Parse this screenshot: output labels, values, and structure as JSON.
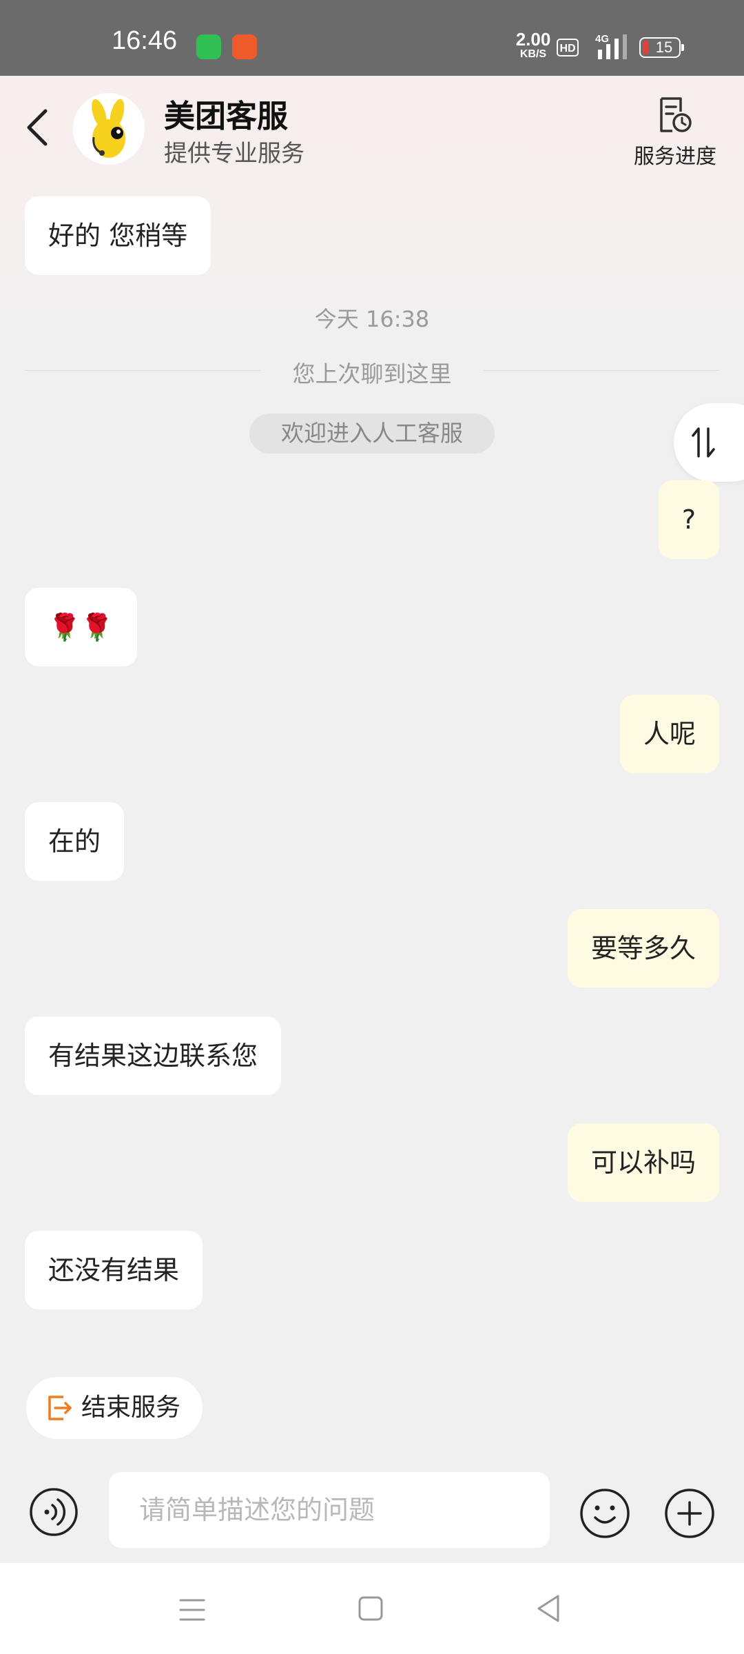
{
  "status_bar": {
    "time": "16:46",
    "net_speed_value": "2.00",
    "net_speed_unit": "KB/S",
    "hd_badge": "HD",
    "network_type": "4G",
    "battery_level": "15",
    "icons": [
      "wechat-app-icon",
      "taobao-app-icon",
      "hd-icon",
      "signal-icon",
      "battery-icon"
    ]
  },
  "header": {
    "title": "美团客服",
    "subtitle": "提供专业服务",
    "progress_label": "服务进度",
    "avatar": "meituan-kangaroo-avatar"
  },
  "chat": {
    "timestamp": "今天 16:38",
    "divider_text": "您上次聊到这里",
    "welcome_text": "欢迎进入人工客服",
    "messages": [
      {
        "side": "in",
        "text": "好的 您稍等"
      },
      {
        "side": "out",
        "text": "?"
      },
      {
        "side": "in",
        "text": "🌹🌹"
      },
      {
        "side": "out",
        "text": "人呢"
      },
      {
        "side": "in",
        "text": "在的"
      },
      {
        "side": "out",
        "text": "要等多久"
      },
      {
        "side": "in",
        "text": "有结果这边联系您"
      },
      {
        "side": "out",
        "text": "可以补吗"
      },
      {
        "side": "in",
        "text": "还没有结果"
      }
    ]
  },
  "bottom": {
    "end_service_label": "结束服务",
    "input_placeholder": "请简单描述您的问题"
  },
  "colors": {
    "outgoing_bubble": "#fefbe2",
    "incoming_bubble": "#ffffff",
    "background": "#f0f0f0",
    "accent_orange": "#f07c1e",
    "status_bar": "#6b6b6b"
  }
}
